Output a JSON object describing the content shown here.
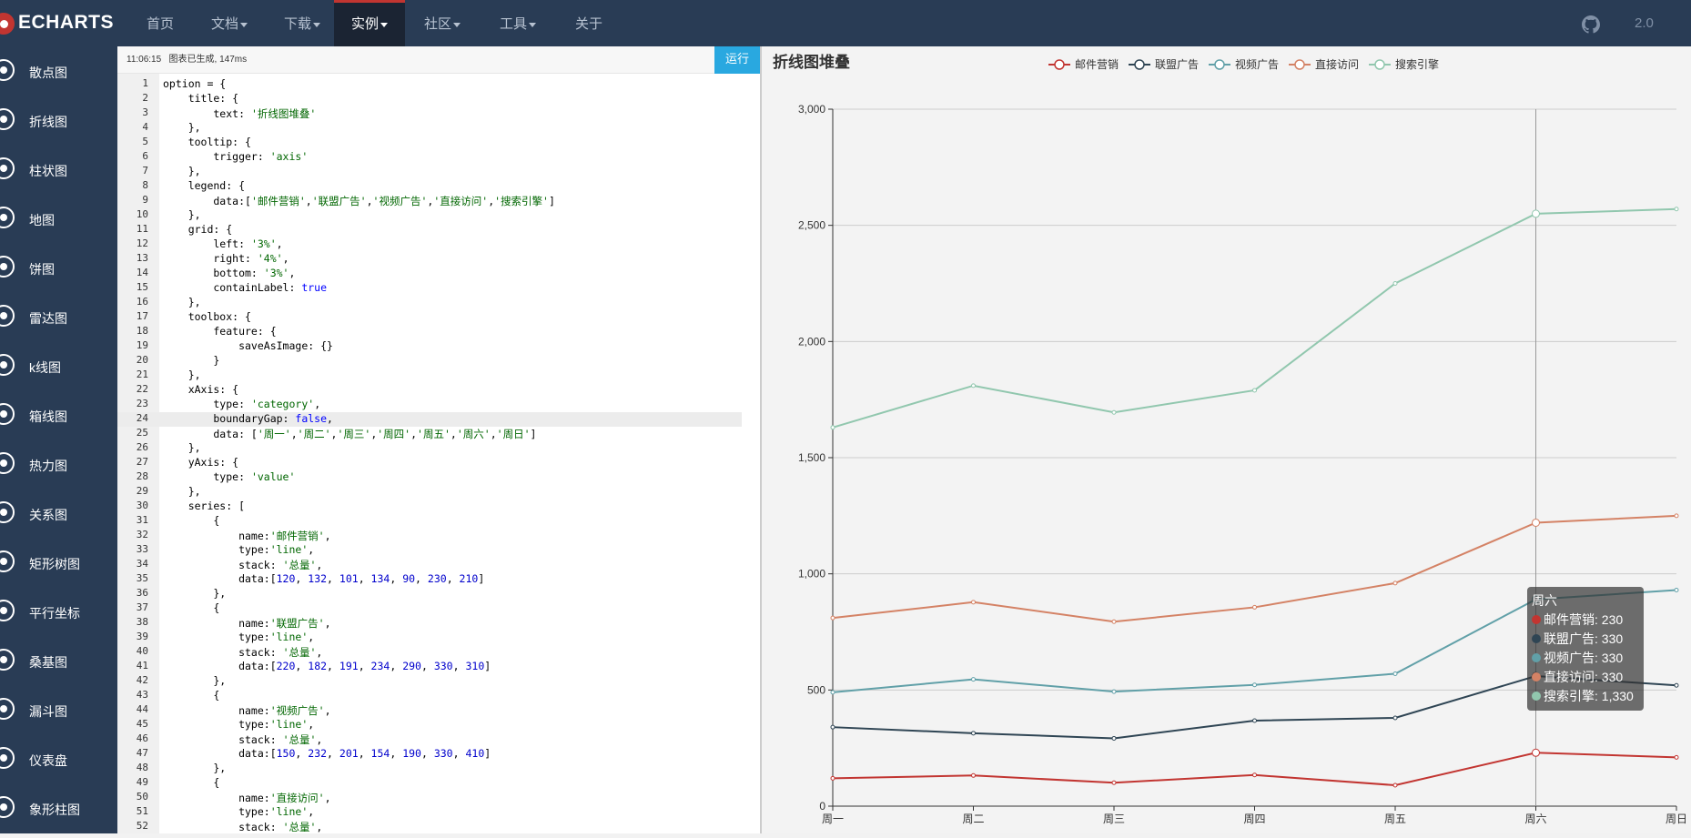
{
  "topbar": {
    "logo": "ECHARTS",
    "nav": [
      {
        "label": "首页",
        "dropdown": false,
        "active": false
      },
      {
        "label": "文档",
        "dropdown": true,
        "active": false
      },
      {
        "label": "下载",
        "dropdown": true,
        "active": false
      },
      {
        "label": "实例",
        "dropdown": true,
        "active": true
      },
      {
        "label": "社区",
        "dropdown": true,
        "active": false
      },
      {
        "label": "工具",
        "dropdown": true,
        "active": false
      },
      {
        "label": "关于",
        "dropdown": false,
        "active": false
      }
    ],
    "github_icon": "github-icon",
    "version": "2.0"
  },
  "sidebar": {
    "items": [
      "散点图",
      "折线图",
      "柱状图",
      "地图",
      "饼图",
      "雷达图",
      "k线图",
      "箱线图",
      "热力图",
      "关系图",
      "矩形树图",
      "平行坐标",
      "桑基图",
      "漏斗图",
      "仪表盘",
      "象形柱图"
    ]
  },
  "editor": {
    "status_time": "11:06:15",
    "status_msg": "图表已生成, 147ms",
    "run_label": "运行",
    "highlight_line": 24,
    "lines": [
      "option = {",
      "    title: {",
      "        text: '折线图堆叠'",
      "    },",
      "    tooltip: {",
      "        trigger: 'axis'",
      "    },",
      "    legend: {",
      "        data:['邮件营销','联盟广告','视频广告','直接访问','搜索引擎']",
      "    },",
      "    grid: {",
      "        left: '3%',",
      "        right: '4%',",
      "        bottom: '3%',",
      "        containLabel: true",
      "    },",
      "    toolbox: {",
      "        feature: {",
      "            saveAsImage: {}",
      "        }",
      "    },",
      "    xAxis: {",
      "        type: 'category',",
      "        boundaryGap: false,",
      "        data: ['周一','周二','周三','周四','周五','周六','周日']",
      "    },",
      "    yAxis: {",
      "        type: 'value'",
      "    },",
      "    series: [",
      "        {",
      "            name:'邮件营销',",
      "            type:'line',",
      "            stack: '总量',",
      "            data:[120, 132, 101, 134, 90, 230, 210]",
      "        },",
      "        {",
      "            name:'联盟广告',",
      "            type:'line',",
      "            stack: '总量',",
      "            data:[220, 182, 191, 234, 290, 330, 310]",
      "        },",
      "        {",
      "            name:'视频广告',",
      "            type:'line',",
      "            stack: '总量',",
      "            data:[150, 232, 201, 154, 190, 330, 410]",
      "        },",
      "        {",
      "            name:'直接访问',",
      "            type:'line',",
      "            stack: '总量',"
    ]
  },
  "chart_data": {
    "type": "line",
    "title": "折线图堆叠",
    "stacked": true,
    "categories": [
      "周一",
      "周二",
      "周三",
      "周四",
      "周五",
      "周六",
      "周日"
    ],
    "ylim": [
      0,
      3000
    ],
    "yticks": [
      0,
      500,
      1000,
      1500,
      2000,
      2500,
      3000
    ],
    "ytick_labels": [
      "0",
      "500",
      "1,000",
      "1,500",
      "2,000",
      "2,500",
      "3,000"
    ],
    "legend_position": "top-center",
    "series": [
      {
        "name": "邮件营销",
        "color": "#c23531",
        "values": [
          120,
          132,
          101,
          134,
          90,
          230,
          210
        ]
      },
      {
        "name": "联盟广告",
        "color": "#2f4554",
        "values": [
          220,
          182,
          191,
          234,
          290,
          330,
          310
        ]
      },
      {
        "name": "视频广告",
        "color": "#61a0a8",
        "values": [
          150,
          232,
          201,
          154,
          190,
          330,
          410
        ]
      },
      {
        "name": "直接访问",
        "color": "#d48265",
        "values": [
          320,
          332,
          301,
          334,
          390,
          330,
          320
        ]
      },
      {
        "name": "搜索引擎",
        "color": "#91c7ae",
        "values": [
          820,
          932,
          901,
          934,
          1290,
          1330,
          1320
        ]
      }
    ],
    "tooltip": {
      "category": "周六",
      "rows": [
        {
          "name": "邮件营销",
          "value": "230"
        },
        {
          "name": "联盟广告",
          "value": "330"
        },
        {
          "name": "视频广告",
          "value": "330"
        },
        {
          "name": "直接访问",
          "value": "330"
        },
        {
          "name": "搜索引擎",
          "value": "1,330"
        }
      ]
    }
  }
}
